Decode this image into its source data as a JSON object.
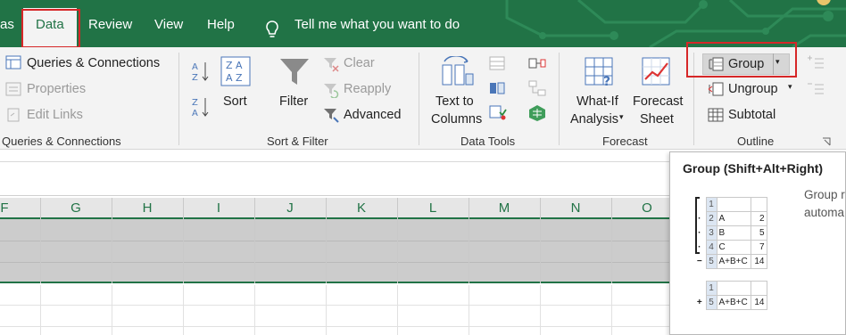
{
  "tabs": {
    "partial": "as",
    "data": "Data",
    "review": "Review",
    "view": "View",
    "help": "Help",
    "tell_me": "Tell me what you want to do"
  },
  "queries": {
    "queries_connections": "Queries & Connections",
    "properties": "Properties",
    "edit_links": "Edit Links",
    "group_label": "Queries & Connections"
  },
  "sortfilter": {
    "sort": "Sort",
    "filter": "Filter",
    "clear": "Clear",
    "reapply": "Reapply",
    "advanced": "Advanced",
    "group_label": "Sort & Filter"
  },
  "datatools": {
    "text_to": "Text to",
    "columns": "Columns",
    "group_label": "Data Tools"
  },
  "forecast": {
    "whatif": "What-If",
    "analysis": "Analysis",
    "forecast": "Forecast",
    "sheet": "Sheet",
    "group_label": "Forecast"
  },
  "outline": {
    "group": "Group",
    "ungroup": "Ungroup",
    "subtotal": "Subtotal",
    "group_label": "Outline"
  },
  "columns": [
    "F",
    "G",
    "H",
    "I",
    "J",
    "K",
    "L",
    "M",
    "N",
    "O"
  ],
  "tooltip": {
    "title": "Group (Shift+Alt+Right)",
    "desc_line1": "Group r",
    "desc_line2": "automa",
    "expanded": [
      {
        "num": "1",
        "name": "",
        "val": "",
        "ctl": ""
      },
      {
        "num": "2",
        "name": "A",
        "val": "2",
        "ctl": "·"
      },
      {
        "num": "3",
        "name": "B",
        "val": "5",
        "ctl": "·"
      },
      {
        "num": "4",
        "name": "C",
        "val": "7",
        "ctl": "·"
      },
      {
        "num": "5",
        "name": "A+B+C",
        "val": "14",
        "ctl": "−"
      }
    ],
    "collapsed": [
      {
        "num": "1",
        "name": "",
        "val": "",
        "ctl": ""
      },
      {
        "num": "5",
        "name": "A+B+C",
        "val": "14",
        "ctl": "+"
      }
    ]
  },
  "colors": {
    "excel_green": "#217346",
    "highlight_red": "#d62728",
    "ribbon_bg": "#f3f3f3",
    "selected_rows": "#cccccc"
  }
}
